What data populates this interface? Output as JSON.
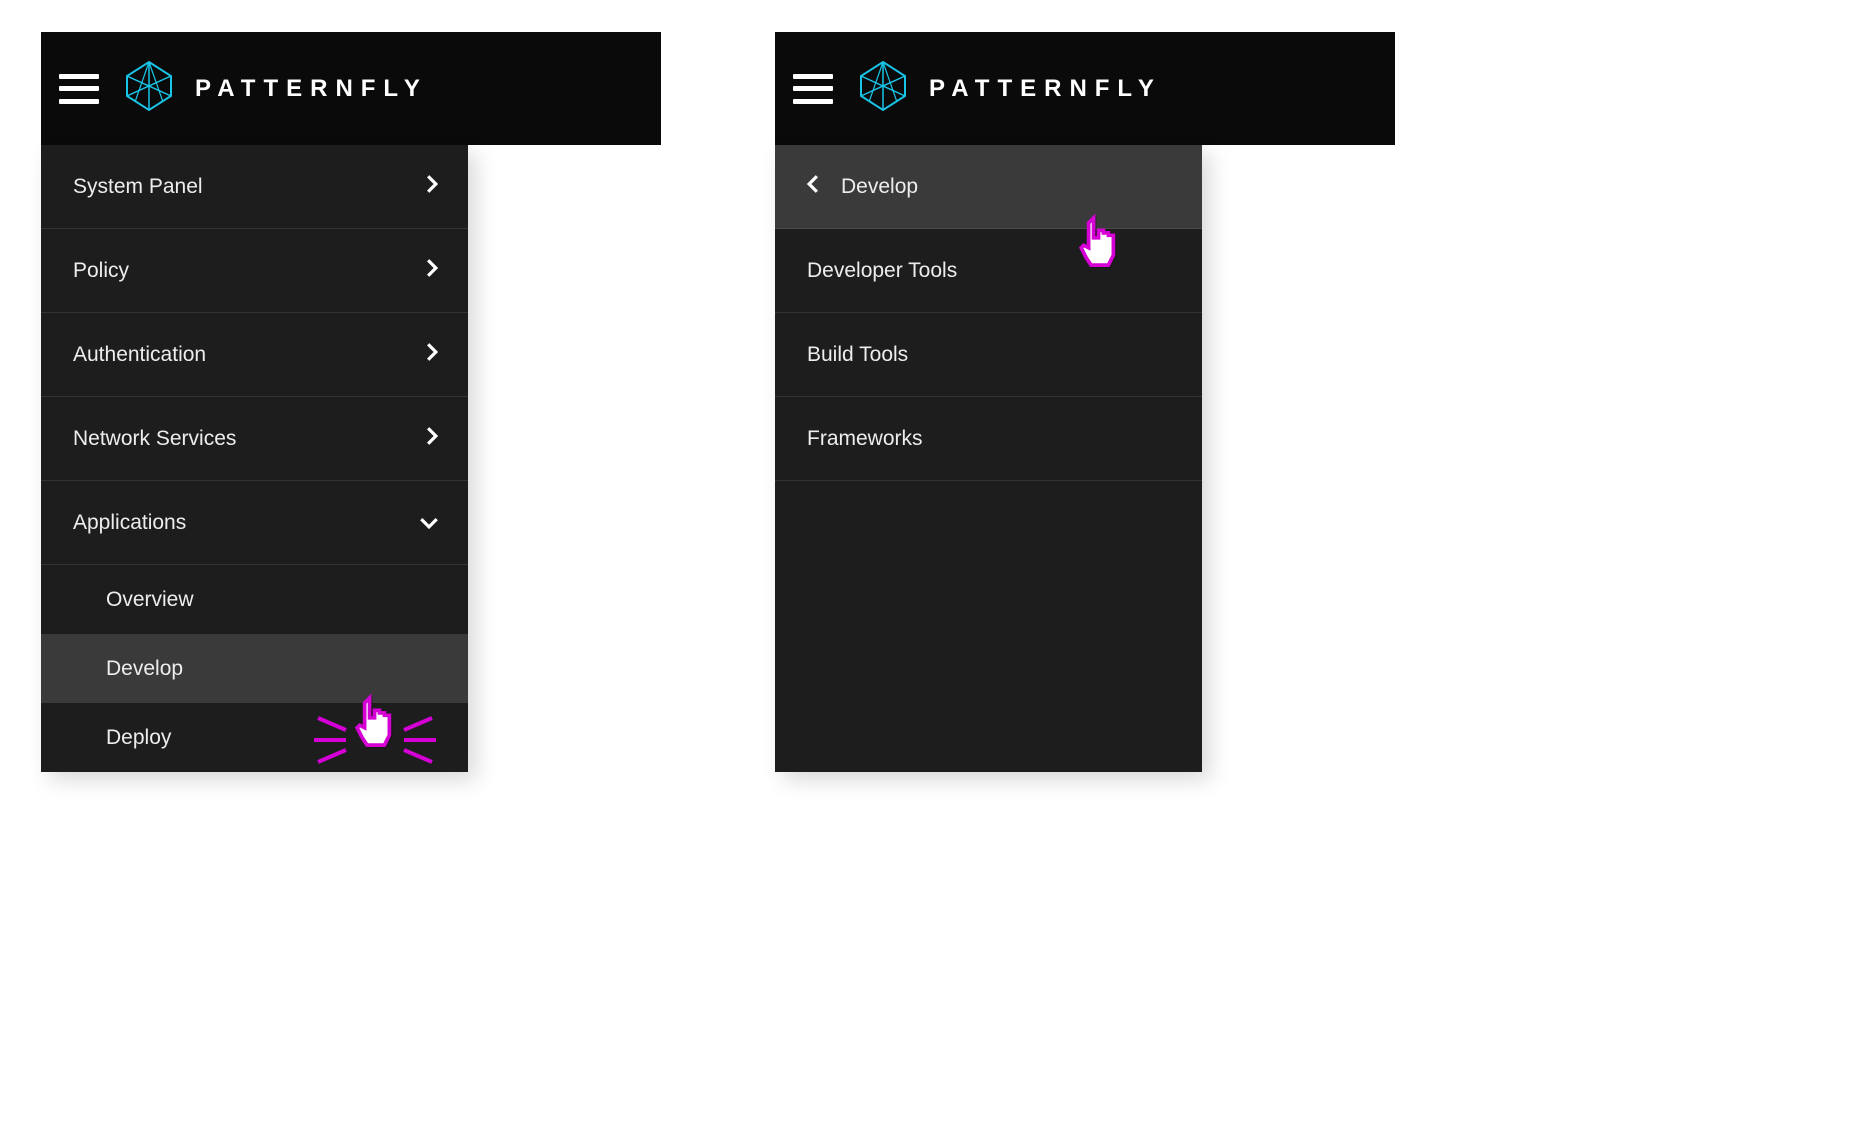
{
  "brand": {
    "name": "PATTERNFLY"
  },
  "left": {
    "nav": [
      {
        "label": "System Panel",
        "expandable": true,
        "expanded": false
      },
      {
        "label": "Policy",
        "expandable": true,
        "expanded": false
      },
      {
        "label": "Authentication",
        "expandable": true,
        "expanded": false
      },
      {
        "label": "Network Services",
        "expandable": true,
        "expanded": false
      },
      {
        "label": "Applications",
        "expandable": true,
        "expanded": true
      }
    ],
    "applications_sub": [
      {
        "label": "Overview",
        "hover": false
      },
      {
        "label": "Develop",
        "hover": true
      },
      {
        "label": "Deploy",
        "hover": false
      }
    ]
  },
  "right": {
    "drill_header": "Develop",
    "items": [
      {
        "label": "Developer Tools"
      },
      {
        "label": "Build Tools"
      },
      {
        "label": "Frameworks"
      }
    ]
  }
}
